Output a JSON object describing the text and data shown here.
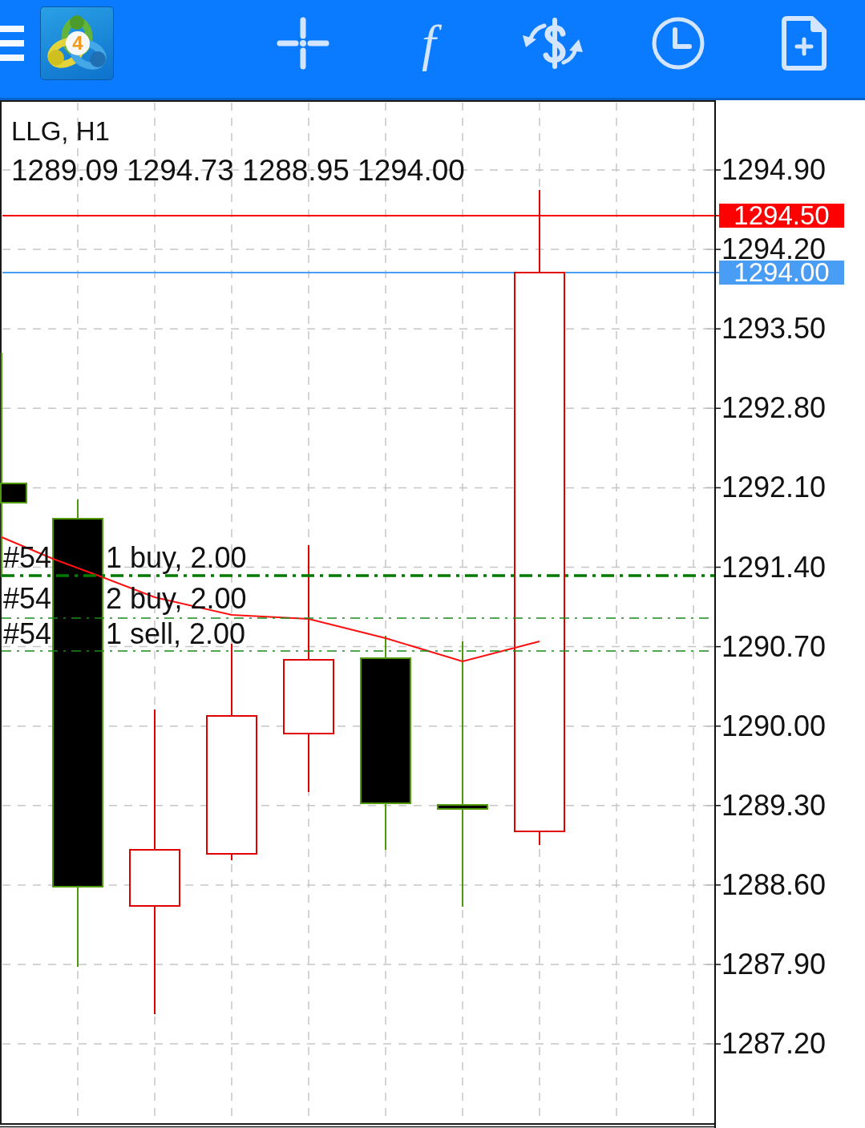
{
  "toolbar": {
    "logo_digit": "4",
    "function_label": "f"
  },
  "chart": {
    "title": "LLG, H1",
    "ohlc": "1289.09 1294.73 1288.95 1294.00",
    "orders": [
      {
        "ticket": "#54",
        "details": "1 buy, 2.00",
        "selected": true
      },
      {
        "ticket": "#54",
        "details": "2 buy, 2.00",
        "selected": false
      },
      {
        "ticket": "#54",
        "details": "1 sell, 2.00",
        "selected": false
      }
    ],
    "price_axis": {
      "labels": [
        "1294.90",
        "1294.20",
        "1293.50",
        "1292.80",
        "1292.10",
        "1291.40",
        "1290.70",
        "1290.00",
        "1289.30",
        "1288.60",
        "1287.90",
        "1287.20"
      ]
    },
    "price_tags": [
      {
        "text": "1294.50",
        "color": "#ff0000"
      },
      {
        "text": "1294.00",
        "color": "#4a9df5"
      }
    ]
  }
}
